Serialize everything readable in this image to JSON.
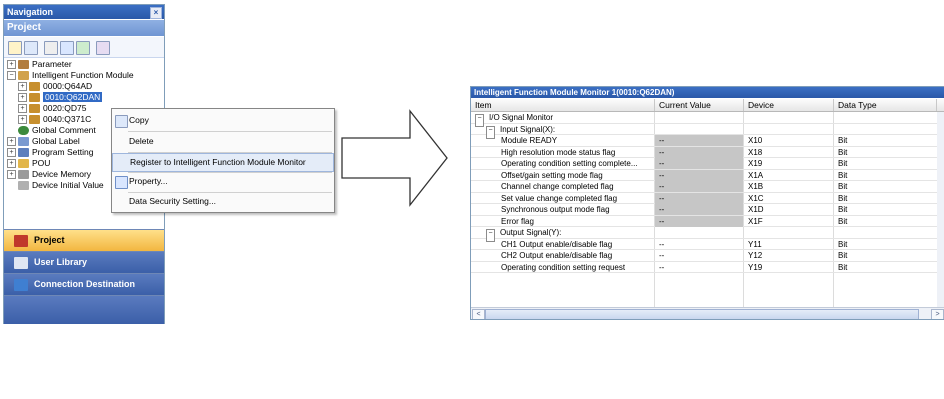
{
  "navigation": {
    "title": "Navigation",
    "close_glyph": "×",
    "section_header": "Project",
    "toolbar_icons": [
      "new-item-icon",
      "copy-icon",
      "paste-icon",
      "property-icon",
      "refresh-icon",
      "network-icon"
    ],
    "tree": [
      {
        "label": "Parameter",
        "expander": "+",
        "icon": "parameter-icon"
      },
      {
        "label": "Intelligent Function Module",
        "expander": "−",
        "icon": "module-folder-icon"
      },
      {
        "label": "0000:Q64AD",
        "expander": "+",
        "icon": "module-icon"
      },
      {
        "label": "0010:Q62DAN",
        "visible": "0010:Q62DAN",
        "expander": "+",
        "icon": "module-icon",
        "selected": true
      },
      {
        "label": "0020:QD75",
        "expander": "+",
        "icon": "module-icon"
      },
      {
        "label": "0040:Q371C",
        "expander": "+",
        "icon": "module-icon"
      },
      {
        "label": "Global Comment",
        "expander": "",
        "icon": "comment-icon"
      },
      {
        "label": "Global Label",
        "expander": "+",
        "icon": "label-icon"
      },
      {
        "label": "Program Setting",
        "expander": "+",
        "icon": "program-icon"
      },
      {
        "label": "POU",
        "expander": "+",
        "icon": "pou-icon"
      },
      {
        "label": "Device Memory",
        "expander": "+",
        "icon": "memory-icon"
      },
      {
        "label": "Device Initial Value",
        "expander": "",
        "icon": "initial-value-icon"
      }
    ],
    "bottom_buttons": [
      "Project",
      "User Library",
      "Connection Destination"
    ],
    "more_glyph": "»"
  },
  "context_menu": {
    "items": [
      {
        "label": "Copy",
        "icon": "copy-icon"
      },
      {
        "label": "Delete",
        "icon": ""
      },
      {
        "label": "Register to Intelligent Function Module Monitor",
        "icon": "",
        "highlighted": true
      },
      {
        "label": "Property...",
        "icon": "property-icon"
      },
      {
        "label": "Data Security Setting...",
        "icon": ""
      }
    ]
  },
  "monitor": {
    "title": "Intelligent Function Module Monitor 1(0010:Q62DAN)",
    "columns": [
      "Item",
      "Current Value",
      "Device",
      "Data Type"
    ],
    "rows": [
      {
        "level": 0,
        "expander": "−",
        "item": "I/O Signal Monitor",
        "value": "",
        "device": "",
        "type": "",
        "grey": false
      },
      {
        "level": 1,
        "expander": "−",
        "item": "Input Signal(X):",
        "value": "",
        "device": "",
        "type": "",
        "grey": false
      },
      {
        "level": 2,
        "expander": "",
        "item": "Module READY",
        "value": "--",
        "device": "X10",
        "type": "Bit",
        "grey": true
      },
      {
        "level": 2,
        "expander": "",
        "item": "High resolution mode status flag",
        "value": "--",
        "device": "X18",
        "type": "Bit",
        "grey": true
      },
      {
        "level": 2,
        "expander": "",
        "item": "Operating condition setting complete...",
        "value": "--",
        "device": "X19",
        "type": "Bit",
        "grey": true
      },
      {
        "level": 2,
        "expander": "",
        "item": "Offset/gain setting mode flag",
        "value": "--",
        "device": "X1A",
        "type": "Bit",
        "grey": true
      },
      {
        "level": 2,
        "expander": "",
        "item": "Channel change completed flag",
        "value": "--",
        "device": "X1B",
        "type": "Bit",
        "grey": true
      },
      {
        "level": 2,
        "expander": "",
        "item": "Set value change completed flag",
        "value": "--",
        "device": "X1C",
        "type": "Bit",
        "grey": true
      },
      {
        "level": 2,
        "expander": "",
        "item": "Synchronous output mode flag",
        "value": "--",
        "device": "X1D",
        "type": "Bit",
        "grey": true
      },
      {
        "level": 2,
        "expander": "",
        "item": "Error flag",
        "value": "--",
        "device": "X1F",
        "type": "Bit",
        "grey": true
      },
      {
        "level": 1,
        "expander": "−",
        "item": "Output Signal(Y):",
        "value": "",
        "device": "",
        "type": "",
        "grey": false
      },
      {
        "level": 2,
        "expander": "",
        "item": "CH1 Output enable/disable flag",
        "value": "--",
        "device": "Y11",
        "type": "Bit",
        "grey": false
      },
      {
        "level": 2,
        "expander": "",
        "item": "CH2 Output enable/disable flag",
        "value": "--",
        "device": "Y12",
        "type": "Bit",
        "grey": false
      },
      {
        "level": 2,
        "expander": "",
        "item": "Operating condition setting request",
        "value": "--",
        "device": "Y19",
        "type": "Bit",
        "grey": false
      }
    ],
    "scroll_left_glyph": "<",
    "scroll_right_glyph": ">"
  },
  "colors": {
    "title_bar": "#2a58a8",
    "selection": "#316ac5",
    "grey_value": "#c6c6c6",
    "project_button": "#f2b640"
  }
}
